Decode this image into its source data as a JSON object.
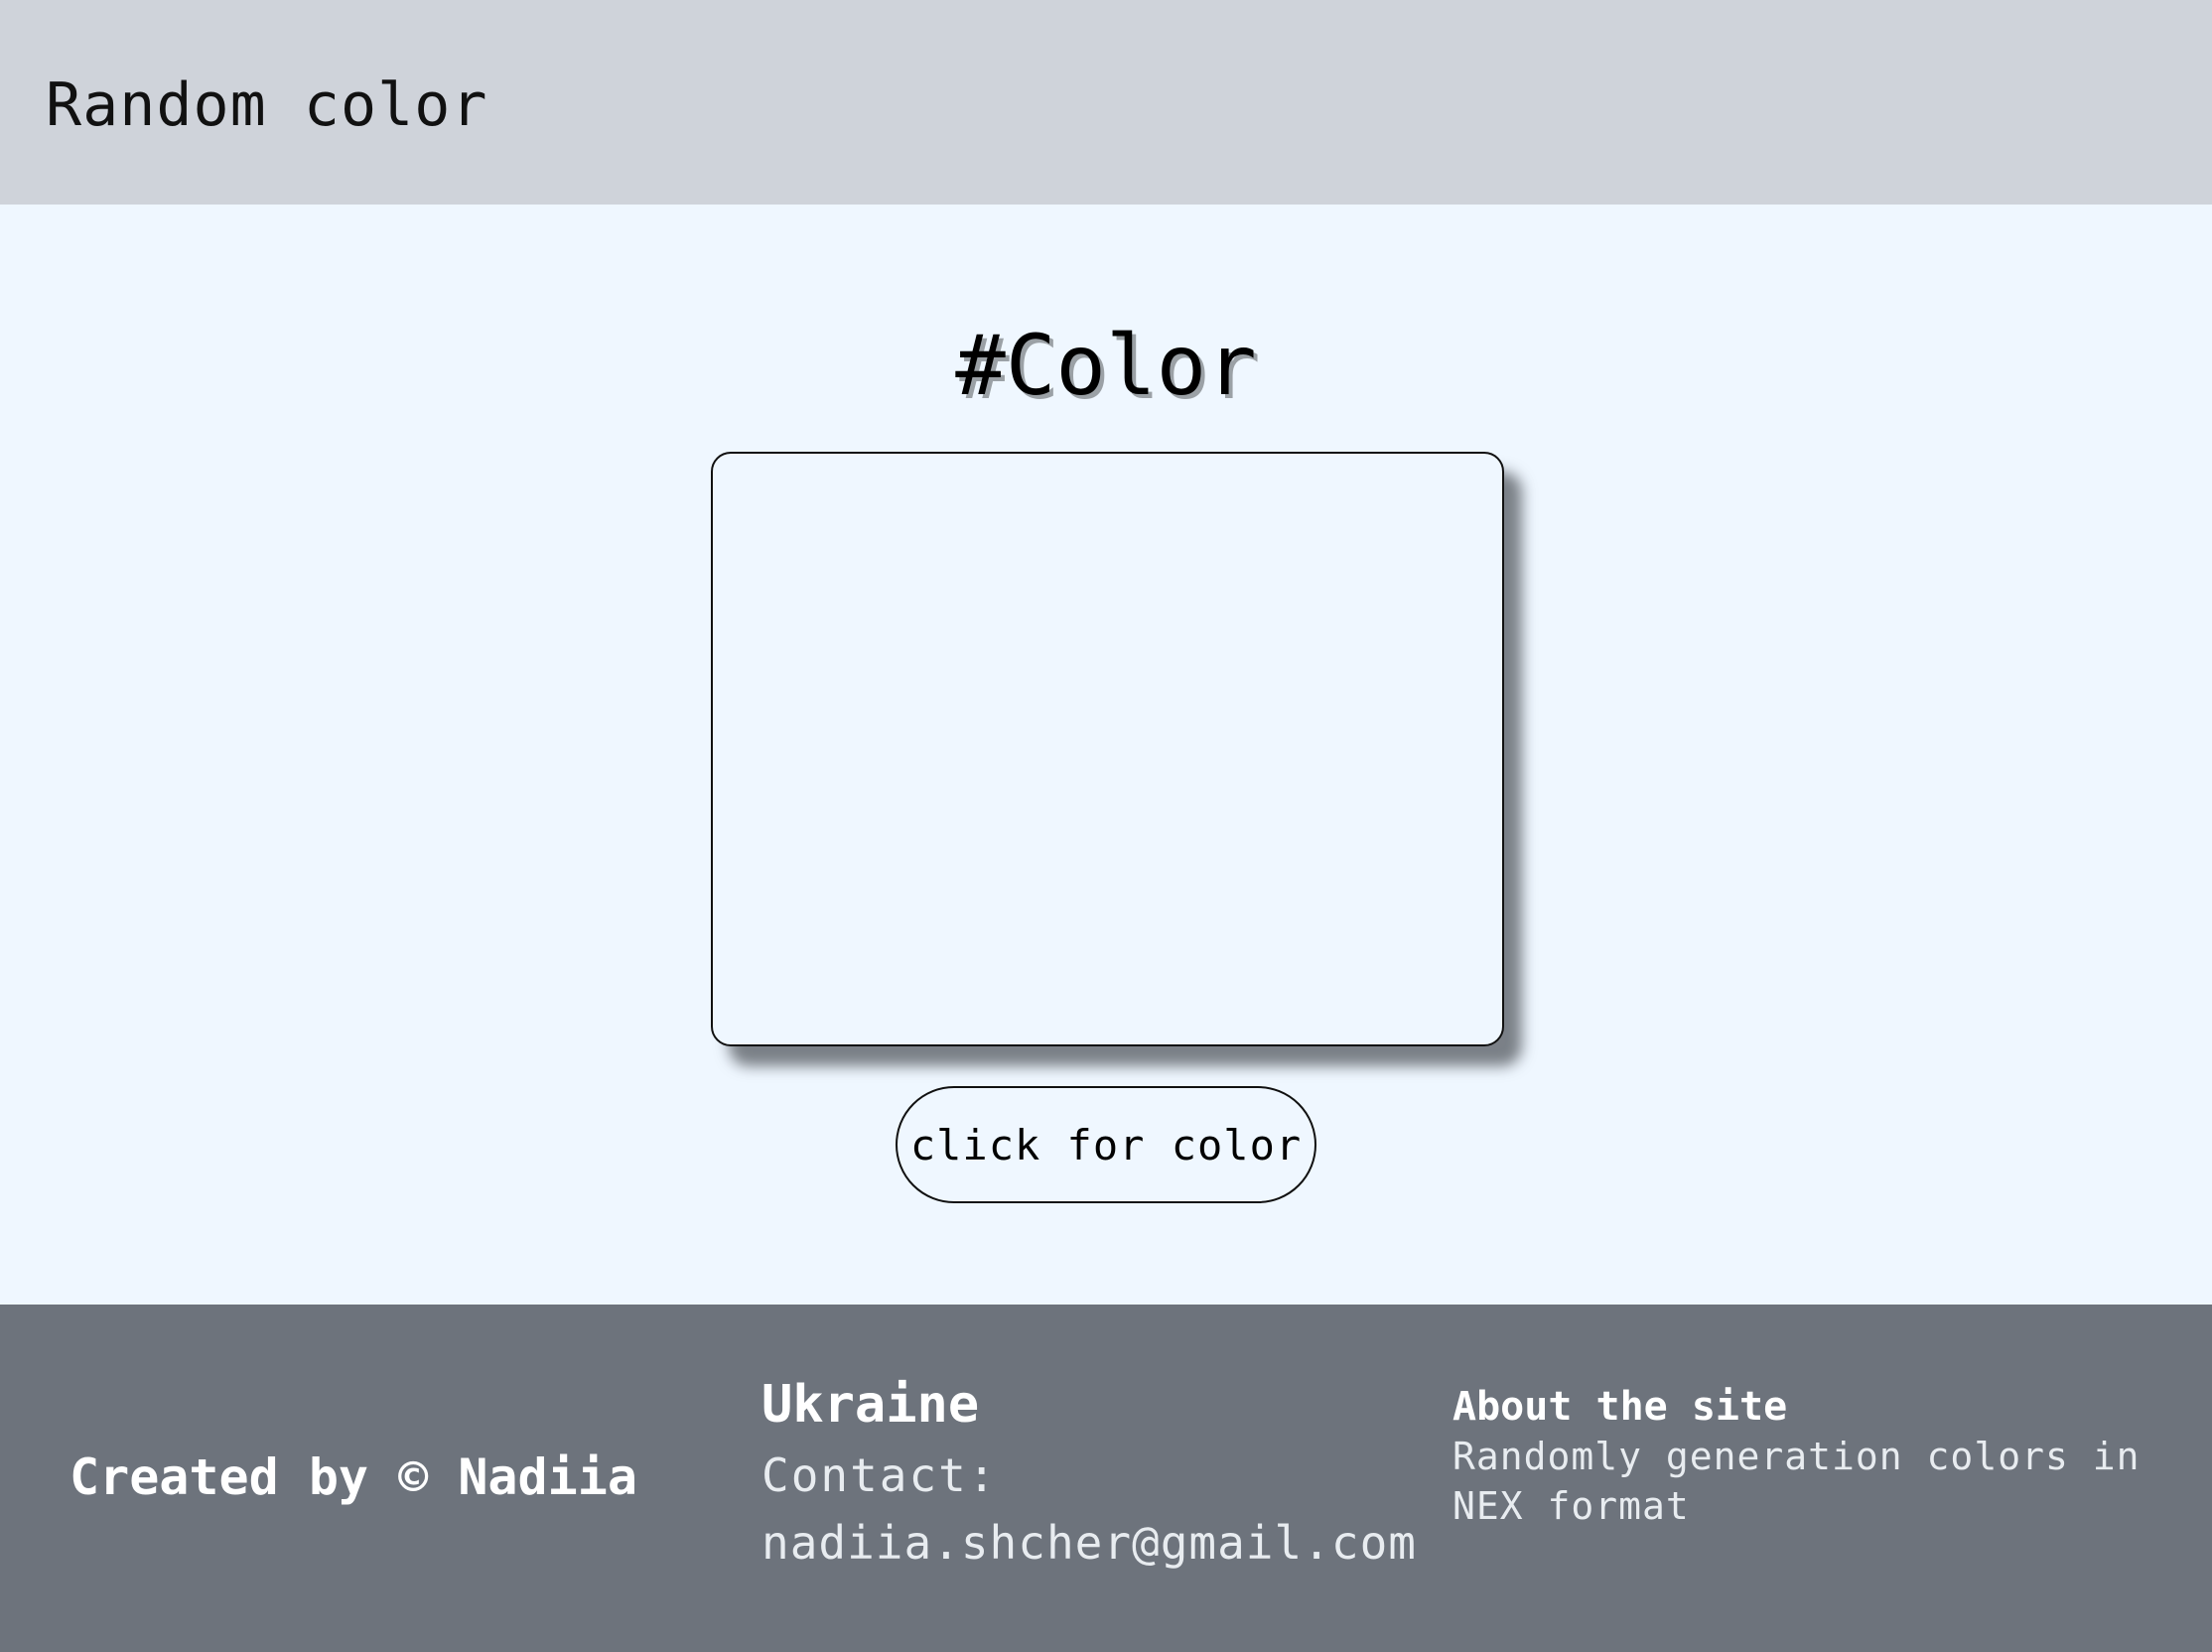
{
  "header": {
    "title": "Random color"
  },
  "main": {
    "heading": "#Color",
    "button_label": "click for color",
    "color_box_color": "#eff7ff"
  },
  "footer": {
    "credit": "Created by © Nadiia",
    "country": "Ukraine",
    "contact_label": "Contact:",
    "contact_email": "nadiia.shcher@gmail.com",
    "about_title": "About the site",
    "about_text": "Randomly generation colors in NEX format"
  },
  "colors": {
    "header_bg": "#cfd3da",
    "main_bg": "#eff7ff",
    "footer_bg": "#6d737c"
  }
}
